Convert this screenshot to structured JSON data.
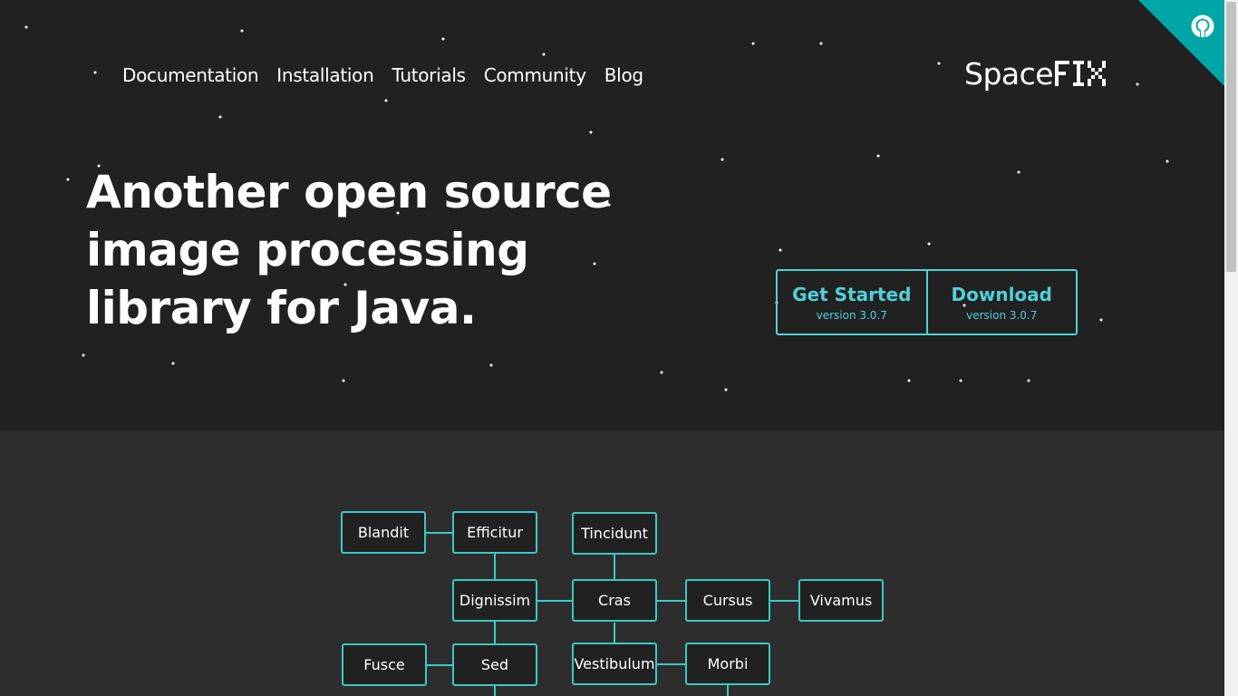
{
  "nav": {
    "items": [
      "Documentation",
      "Installation",
      "Tutorials",
      "Community",
      "Blog"
    ]
  },
  "brand": {
    "name_light": "Space",
    "name_pixel": "FIX",
    "accent": "#4fd1d9"
  },
  "hero": {
    "headline": "Another open source image processing library for Java."
  },
  "cta": {
    "get_started": {
      "title": "Get Started",
      "sub": "version 3.0.7"
    },
    "download": {
      "title": "Download",
      "sub": "version 3.0.7"
    }
  },
  "corner": {
    "icon": "github-icon",
    "color": "#00a6a6"
  },
  "tree": {
    "nodes": [
      {
        "id": "blandit",
        "label": "Blandit"
      },
      {
        "id": "efficitur",
        "label": "Efficitur"
      },
      {
        "id": "tincidunt",
        "label": "Tincidunt"
      },
      {
        "id": "dignissim",
        "label": "Dignissim"
      },
      {
        "id": "cras",
        "label": "Cras"
      },
      {
        "id": "cursus",
        "label": "Cursus"
      },
      {
        "id": "vivamus",
        "label": "Vivamus"
      },
      {
        "id": "fusce",
        "label": "Fusce"
      },
      {
        "id": "sed",
        "label": "Sed"
      },
      {
        "id": "vestibulum",
        "label": "Vestibulum"
      },
      {
        "id": "morbi",
        "label": "Morbi"
      }
    ]
  }
}
